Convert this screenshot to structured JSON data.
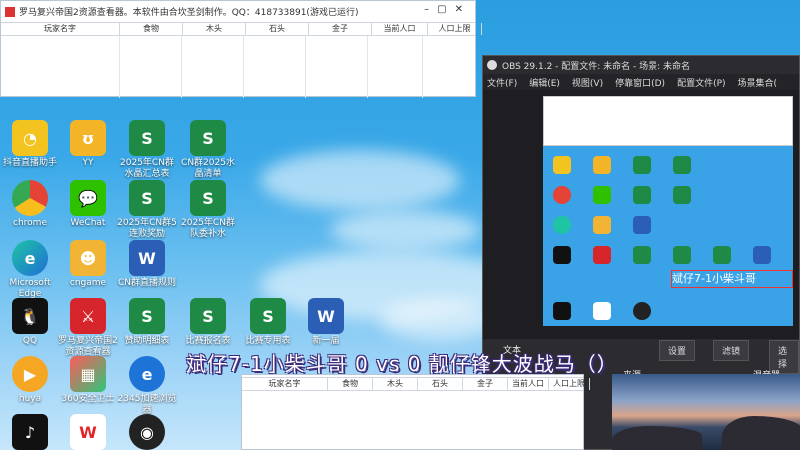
{
  "viewer": {
    "title": "罗马复兴帝国2资源查看器。本软件由合坎圣剑制作。QQ：418733891(游戏已运行)",
    "columns": [
      "玩家名字",
      "食物",
      "木头",
      "石头",
      "金子",
      "当前人口",
      "人口上限"
    ]
  },
  "desktop_icons": [
    {
      "label": "抖音直播助手",
      "name": "douyin-live-icon"
    },
    {
      "label": "YY",
      "name": "yy-icon"
    },
    {
      "label": "2025年CN群水晶汇总表",
      "name": "excel-doc-icon"
    },
    {
      "label": "CN群2025水晶清单",
      "name": "excel-doc-icon"
    },
    {
      "label": "chrome",
      "name": "chrome-icon"
    },
    {
      "label": "WeChat",
      "name": "wechat-icon"
    },
    {
      "label": "2025年CN群5连败奖励",
      "name": "excel-doc-icon"
    },
    {
      "label": "2025年CN群队委补水",
      "name": "excel-doc-icon"
    },
    {
      "label": "Microsoft Edge",
      "name": "edge-icon"
    },
    {
      "label": "cngame",
      "name": "cngame-icon"
    },
    {
      "label": "CN群直播规则",
      "name": "word-doc-icon"
    },
    {
      "label": "QQ",
      "name": "qq-icon"
    },
    {
      "label": "罗马复兴帝国2资源查看器",
      "name": "resource-viewer-icon"
    },
    {
      "label": "赞助明细表",
      "name": "excel-doc-icon"
    },
    {
      "label": "比赛报名表",
      "name": "excel-doc-icon"
    },
    {
      "label": "比赛专用表",
      "name": "excel-doc-icon"
    },
    {
      "label": "新一届",
      "name": "word-doc-icon"
    },
    {
      "label": "huya",
      "name": "huya-icon"
    },
    {
      "label": "360安全卫士",
      "name": "security-icon"
    },
    {
      "label": "2345加速浏览器",
      "name": "ie-icon"
    },
    {
      "label": "",
      "name": "tiktok-icon"
    },
    {
      "label": "",
      "name": "wps-icon"
    },
    {
      "label": "",
      "name": "obs-icon"
    }
  ],
  "obs": {
    "title": "OBS 29.1.2 - 配置文件: 未命名 - 场景: 未命名",
    "menu": [
      "文件(F)",
      "编辑(E)",
      "视图(V)",
      "停靠窗口(D)",
      "配置文件(P)",
      "场景集合("
    ],
    "preview_overlay": "斌仔7-1小柴斗哥",
    "buttons": [
      "设置",
      "滤镜",
      "选择"
    ],
    "tabs": [
      "文本",
      "来源",
      "混音器"
    ]
  },
  "overlay_text": "斌仔7-1小柴斗哥 0 vs 0  靓仔锋大波战马（）",
  "grid2": {
    "columns": [
      "玩家名字",
      "食物",
      "木头",
      "石头",
      "金子",
      "当前人口",
      "人口上限"
    ]
  }
}
